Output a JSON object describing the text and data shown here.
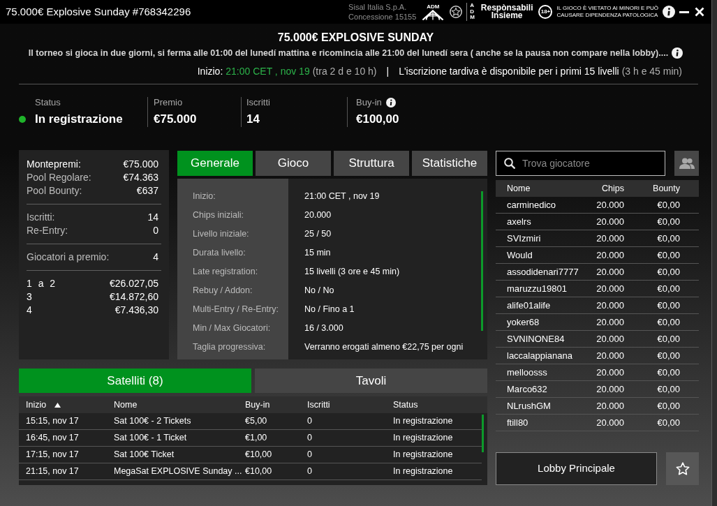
{
  "window": {
    "title": "75.000€ Explosive Sunday #768342296"
  },
  "operator": {
    "name": "Sisal Italia S.p.A.",
    "license": "Concessione 15155"
  },
  "logos": {
    "adm_caption": "ADM",
    "adm_vertical": "ADM",
    "campaign_lines": [
      "Respònsabili",
      "Insieme"
    ],
    "age_badge": "18+",
    "warning_lines": [
      "IL GIOCO È VIETATO AI MINORI E PUÒ",
      "CAUSARE DIPENDENZA PATOLOGICA"
    ]
  },
  "header": {
    "title": "75.000€ EXPLOSIVE SUNDAY",
    "notice": "Il torneo si gioca in due giorni, si ferma alle 01:00 del lunedí mattina e ricomincia alle 21:00 del lunedí sera ( anche se la pausa non compare nella lobby)....",
    "start_label": "Inizio:",
    "start_value": "21:00 CET , nov 19",
    "start_countdown": "(tra 2 d e 10 h)",
    "separator": "|",
    "late_registration": "L'iscrizione tardiva è disponibile per i primi 15 livelli",
    "late_duration": "(3 h e 45 min)"
  },
  "stats": [
    {
      "label": "Status",
      "value": "In registrazione",
      "kind": "status",
      "color": "#1fb32a"
    },
    {
      "label": "Premio",
      "value": "€75.000",
      "kind": "plain"
    },
    {
      "label": "Iscritti",
      "value": "14",
      "kind": "plain"
    },
    {
      "label": "Buy-in",
      "value": "€100,00",
      "kind": "info"
    }
  ],
  "prize_summary": [
    [
      {
        "label": "Montepremi:",
        "value": "€75.000",
        "kind": "main"
      },
      {
        "label": "Pool Regolare:",
        "value": "€74.363",
        "kind": "detail"
      },
      {
        "label": "Pool Bounty:",
        "value": "€637",
        "kind": "detail"
      }
    ],
    [
      {
        "label": "Iscritti:",
        "value": "14",
        "kind": "detail"
      },
      {
        "label": "Re-Entry:",
        "value": "0",
        "kind": "detail"
      }
    ],
    [
      {
        "label": "Giocatori a premio:",
        "value": "4",
        "kind": "detail"
      }
    ],
    [
      {
        "label": "1 a 2",
        "value": "€26.027,05",
        "kind": "payout"
      },
      {
        "label": "3",
        "value": "€14.872,60",
        "kind": "payout"
      },
      {
        "label": "4",
        "value": "€7.436,30",
        "kind": "payout"
      }
    ]
  ],
  "info_tabs": [
    {
      "label": "Generale",
      "selected": true
    },
    {
      "label": "Gioco",
      "selected": false
    },
    {
      "label": "Struttura",
      "selected": false
    },
    {
      "label": "Statistiche",
      "selected": false
    }
  ],
  "details": [
    {
      "label": "Inizio:",
      "value": "21:00 CET , nov 19"
    },
    {
      "label": "Chips iniziali:",
      "value": "20.000"
    },
    {
      "label": "Livello iniziale:",
      "value": "25 / 50"
    },
    {
      "label": "Durata livello:",
      "value": "15 min"
    },
    {
      "label": "Late registration:",
      "value": "15 livelli (3 ore e 45 min)"
    },
    {
      "label": "Rebuy / Addon:",
      "value": "No / No"
    },
    {
      "label": "Multi-Entry / Re-Entry:",
      "value": "No / Fino a 1"
    },
    {
      "label": "Min / Max Giocatori:",
      "value": "16 / 3.000"
    },
    {
      "label": "Taglia progressiva:",
      "value": "Verranno erogati almeno €22,75 per ogni"
    }
  ],
  "satellite_tabs": [
    {
      "label": "Satelliti (8)",
      "selected": true
    },
    {
      "label": "Tavoli",
      "selected": false
    }
  ],
  "satellites": {
    "columns": [
      {
        "label": "Inizio",
        "sorted": true
      },
      {
        "label": "Nome",
        "sorted": false
      },
      {
        "label": "Buy-in",
        "sorted": false
      },
      {
        "label": "Iscritti",
        "sorted": false
      },
      {
        "label": "Status",
        "sorted": false
      }
    ],
    "rows": [
      [
        "15:15, nov 17",
        "Sat 100€ - 2 Tickets",
        "€5,00",
        "0",
        "In registrazione"
      ],
      [
        "16:45, nov 17",
        "Sat 100€ - 1 Ticket",
        "€1,00",
        "0",
        "In registrazione"
      ],
      [
        "17:15, nov 17",
        "Sat 100€ Ticket",
        "€10,00",
        "0",
        "In registrazione"
      ],
      [
        "21:15, nov 17",
        "MegaSat EXPLOSIVE Sunday ...",
        "€10,00",
        "0",
        "In registrazione"
      ]
    ]
  },
  "player_search": {
    "placeholder": "Trova giocatore"
  },
  "players": {
    "columns": [
      "Nome",
      "Chips",
      "Bounty"
    ],
    "rows": [
      [
        "carminedico",
        "20.000",
        "€0,00"
      ],
      [
        "axelrs",
        "20.000",
        "€0,00"
      ],
      [
        "SVIzmiri",
        "20.000",
        "€0,00"
      ],
      [
        "Would",
        "20.000",
        "€0,00"
      ],
      [
        "assodidenari7777",
        "20.000",
        "€0,00"
      ],
      [
        "maruzzu19801",
        "20.000",
        "€0,00"
      ],
      [
        "alife01alife",
        "20.000",
        "€0,00"
      ],
      [
        "yoker68",
        "20.000",
        "€0,00"
      ],
      [
        "SVNINONE84",
        "20.000",
        "€0,00"
      ],
      [
        "laccalappianana",
        "20.000",
        "€0,00"
      ],
      [
        "melloosss",
        "20.000",
        "€0,00"
      ],
      [
        "Marco632",
        "20.000",
        "€0,00"
      ],
      [
        "NLrushGM",
        "20.000",
        "€0,00"
      ],
      [
        "ftill80",
        "20.000",
        "€0,00"
      ]
    ]
  },
  "lobby_button": "Lobby Principale"
}
